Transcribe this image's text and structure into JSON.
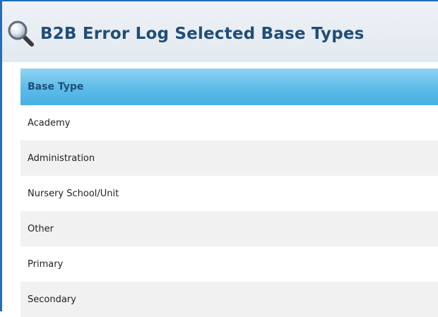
{
  "header": {
    "title": "B2B Error Log Selected Base Types",
    "icon": "search-icon"
  },
  "table": {
    "columns": [
      "Base Type"
    ],
    "rows": [
      "Academy",
      "Administration",
      "Nursery School/Unit",
      "Other",
      "Primary",
      "Secondary"
    ]
  },
  "colors": {
    "title": "#1f4e79",
    "frame_border": "#1f6fbf",
    "header_bar": "#5cbbe8",
    "row_alt": "#f1f1f1"
  }
}
